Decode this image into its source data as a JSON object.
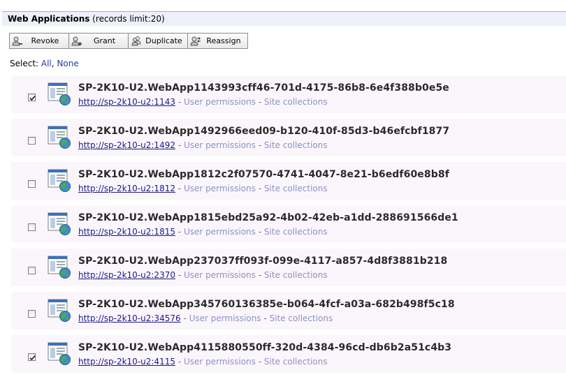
{
  "header": {
    "title": "Web Applications",
    "limit": "(records limit:20)"
  },
  "toolbar": {
    "revoke_label": "Revoke",
    "grant_label": "Grant",
    "duplicate_label": "Duplicate",
    "reassign_label": "Reassign"
  },
  "select": {
    "label": "Select:",
    "all": "All",
    "none": "None"
  },
  "links": {
    "separator": "-",
    "user_permissions": "User permissions",
    "site_collections": "Site collections"
  },
  "rows": [
    {
      "name": "SP-2K10-U2.WebApp1143993cff46-701d-4175-86b8-6e4f388b0e5e",
      "url": "http://sp-2k10-u2:1143",
      "checked": true
    },
    {
      "name": "SP-2K10-U2.WebApp1492966eed09-b120-410f-85d3-b46efcbf1877",
      "url": "http://sp-2k10-u2:1492",
      "checked": false
    },
    {
      "name": "SP-2K10-U2.WebApp1812c2f07570-4741-4047-8e21-b6edf60e8b8f",
      "url": "http://sp-2k10-u2:1812",
      "checked": false
    },
    {
      "name": "SP-2K10-U2.WebApp1815ebd25a92-4b02-42eb-a1dd-288691566de1",
      "url": "http://sp-2k10-u2:1815",
      "checked": false
    },
    {
      "name": "SP-2K10-U2.WebApp237037ff093f-099e-4117-a857-4d8f3881b218",
      "url": "http://sp-2k10-u2:2370",
      "checked": false
    },
    {
      "name": "SP-2K10-U2.WebApp345760136385e-b064-4fcf-a03a-682b498f5c18",
      "url": "http://sp-2k10-u2:34576",
      "checked": false
    },
    {
      "name": "SP-2K10-U2.WebApp4115880550ff-320d-4384-96cd-db6b2a51c4b3",
      "url": "http://sp-2k10-u2:4115",
      "checked": true
    }
  ]
}
